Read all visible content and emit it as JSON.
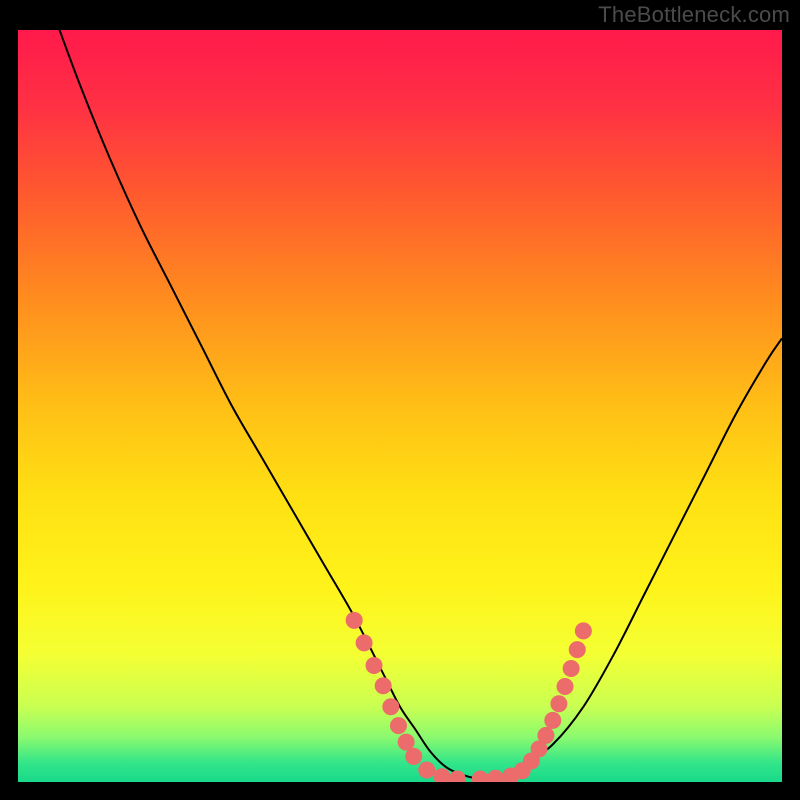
{
  "watermark": "TheBottleneck.com",
  "colors": {
    "bg": "#000000",
    "watermark": "#4b4b4b",
    "curve_stroke": "#000000",
    "marker_fill": "#ec6b6b",
    "marker_stroke": "#ec6b6b",
    "gradient_stops": [
      {
        "offset": 0.0,
        "color": "#ff1a4b"
      },
      {
        "offset": 0.1,
        "color": "#ff3044"
      },
      {
        "offset": 0.22,
        "color": "#ff5a2e"
      },
      {
        "offset": 0.35,
        "color": "#ff8a1f"
      },
      {
        "offset": 0.5,
        "color": "#ffbf16"
      },
      {
        "offset": 0.62,
        "color": "#ffe013"
      },
      {
        "offset": 0.74,
        "color": "#fff31a"
      },
      {
        "offset": 0.83,
        "color": "#f4ff33"
      },
      {
        "offset": 0.9,
        "color": "#c9ff52"
      },
      {
        "offset": 0.94,
        "color": "#8bfa6e"
      },
      {
        "offset": 0.975,
        "color": "#32e58a"
      },
      {
        "offset": 1.0,
        "color": "#19d98a"
      }
    ]
  },
  "chart_data": {
    "type": "line",
    "title": "",
    "xlabel": "",
    "ylabel": "",
    "xlim": [
      0,
      100
    ],
    "ylim": [
      0,
      100
    ],
    "grid": false,
    "legend": false,
    "series": [
      {
        "name": "bottleneck-curve",
        "x": [
          0,
          4,
          8,
          12,
          16,
          20,
          24,
          28,
          32,
          36,
          40,
          44,
          48,
          50,
          52,
          54,
          56,
          58,
          60,
          62,
          64,
          66,
          70,
          74,
          78,
          82,
          86,
          90,
          94,
          98,
          100
        ],
        "y": [
          115,
          104,
          93,
          83,
          74,
          66,
          58,
          50,
          43,
          36,
          29,
          22,
          14,
          10,
          7,
          4,
          2,
          1,
          0.5,
          0.5,
          1,
          2,
          5,
          10,
          17,
          25,
          33,
          41,
          49,
          56,
          59
        ]
      }
    ],
    "markers": [
      {
        "x": 44.0,
        "y": 21.5
      },
      {
        "x": 45.3,
        "y": 18.5
      },
      {
        "x": 46.6,
        "y": 15.5
      },
      {
        "x": 47.8,
        "y": 12.8
      },
      {
        "x": 48.8,
        "y": 10.0
      },
      {
        "x": 49.8,
        "y": 7.5
      },
      {
        "x": 50.8,
        "y": 5.3
      },
      {
        "x": 51.8,
        "y": 3.4
      },
      {
        "x": 53.5,
        "y": 1.6
      },
      {
        "x": 55.5,
        "y": 0.7
      },
      {
        "x": 57.5,
        "y": 0.4
      },
      {
        "x": 60.5,
        "y": 0.4
      },
      {
        "x": 62.5,
        "y": 0.5
      },
      {
        "x": 64.5,
        "y": 0.8
      },
      {
        "x": 66.0,
        "y": 1.5
      },
      {
        "x": 67.2,
        "y": 2.8
      },
      {
        "x": 68.2,
        "y": 4.4
      },
      {
        "x": 69.1,
        "y": 6.2
      },
      {
        "x": 70.0,
        "y": 8.2
      },
      {
        "x": 70.8,
        "y": 10.4
      },
      {
        "x": 71.6,
        "y": 12.7
      },
      {
        "x": 72.4,
        "y": 15.1
      },
      {
        "x": 73.2,
        "y": 17.6
      },
      {
        "x": 74.0,
        "y": 20.1
      }
    ],
    "marker_radius_px": 8
  }
}
